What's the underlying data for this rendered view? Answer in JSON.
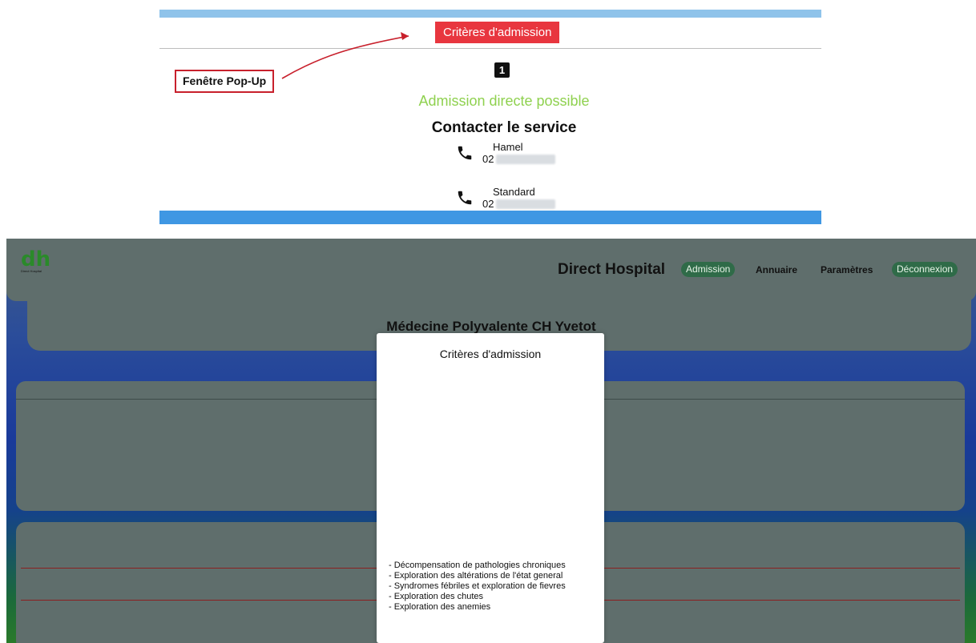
{
  "excerpt": {
    "tab_label": "Critères d'admission",
    "step_number": "1",
    "status_text": "Admission directe possible",
    "contact_title": "Contacter le service",
    "contacts": [
      {
        "name": "Hamel",
        "number_prefix": "02"
      },
      {
        "name": "Standard",
        "number_prefix": "02"
      }
    ],
    "callout": "Fenêtre Pop-Up"
  },
  "app": {
    "brand": "Direct Hospital",
    "logo_text": "dh",
    "logo_sub": "Direct Hospital",
    "nav": {
      "admission": "Admission",
      "annuaire": "Annuaire",
      "parametres": "Paramètres",
      "deconnexion": "Déconnexion"
    },
    "service_title": "Médecine Polyvalente CH Yvetot",
    "modal": {
      "title": "Critères d'admission",
      "criteria": [
        "- Décompensation de pathologies chroniques",
        "- Exploration des altérations de l'état general",
        "- Syndromes fébriles et exploration de fievres",
        "- Exploration des chutes",
        "- Exploration des anemies"
      ]
    }
  },
  "colors": {
    "accent_red": "#e8363f",
    "success_green": "#8fd14f",
    "pill_green": "#2f6b48",
    "header_blue": "#3f97e3"
  }
}
